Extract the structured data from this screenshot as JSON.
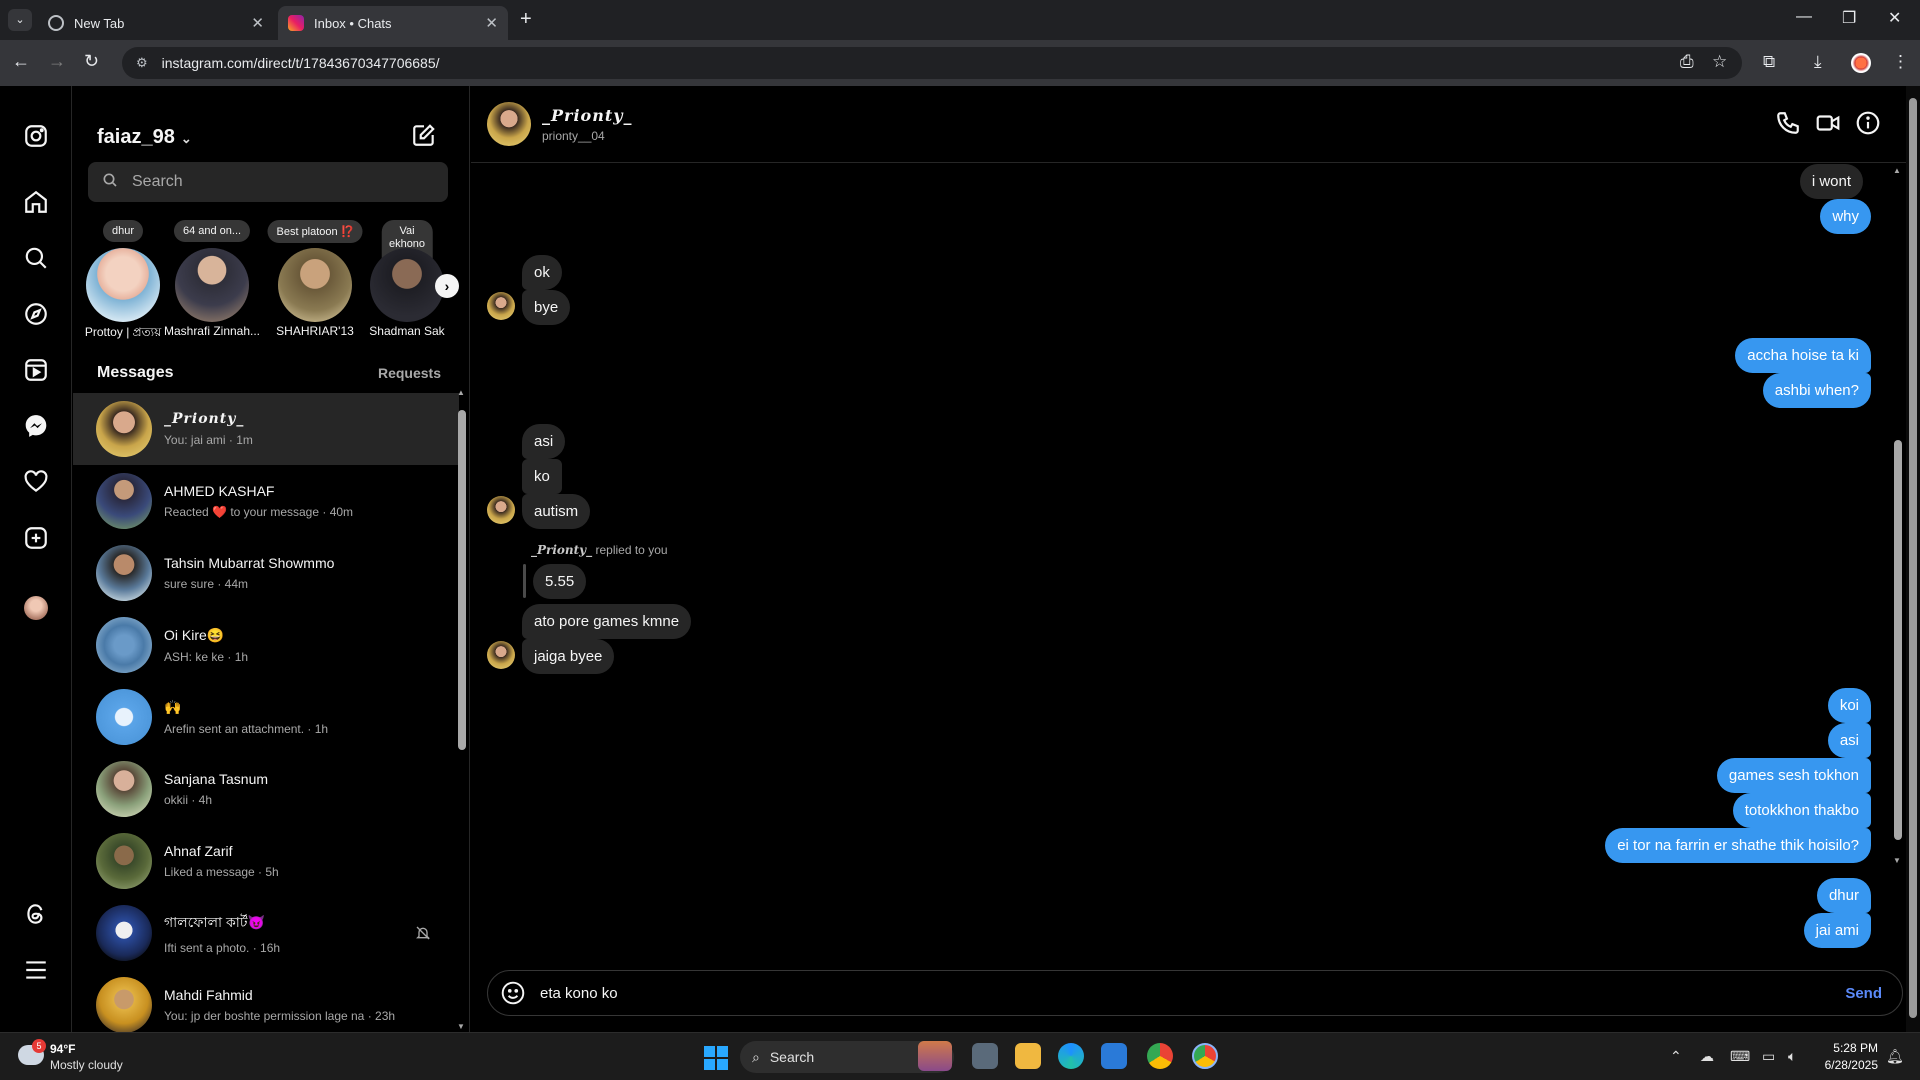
{
  "browser": {
    "tabs": [
      {
        "title": "New Tab",
        "active": false
      },
      {
        "title": "Inbox • Chats",
        "active": true
      }
    ],
    "url": "instagram.com/direct/t/17843670347706685/"
  },
  "inbox": {
    "username": "faiaz_98",
    "search_placeholder": "Search",
    "notes": [
      {
        "note": "dhur",
        "name": "Prottoy | প্রত্যয়"
      },
      {
        "note": "64 and on...",
        "name": "Mashrafi Zinnah..."
      },
      {
        "note": "Best platoon ⁉️",
        "name": "SHAHRIAR'13"
      },
      {
        "note": "Vai ekhono onekdin ba",
        "name": "Shadman Sak"
      }
    ],
    "messages_heading": "Messages",
    "requests_label": "Requests",
    "conversations": [
      {
        "name": "_Prionty_",
        "preview": "You: jai ami · 1m",
        "active": true
      },
      {
        "name": "AHMED KASHAF",
        "preview_before": "Reacted ",
        "preview_heart": "❤️",
        "preview_after": " to your message · 40m"
      },
      {
        "name": "Tahsin Mubarrat Showmmo",
        "preview": "sure sure · 44m"
      },
      {
        "name": "Oi Kire😆",
        "preview": "ASH: ke ke · 1h"
      },
      {
        "name": "🙌",
        "preview": "Arefin sent an attachment. · 1h"
      },
      {
        "name": "Sanjana Tasnum",
        "preview": "okkii · 4h"
      },
      {
        "name": "Ahnaf Zarif",
        "preview": "Liked a message · 5h"
      },
      {
        "name": "গালফোলা কার্ট😈",
        "preview": "Ifti sent a photo. · 16h",
        "muted": true
      },
      {
        "name": "Mahdi Fahmid",
        "preview": "You: jp der boshte permission lage na · 23h"
      }
    ]
  },
  "chat": {
    "header_name": "_Prionty_",
    "header_handle": "prionty__04",
    "messages": [
      {
        "from": "me",
        "text": "i wont",
        "style": "grey"
      },
      {
        "from": "me",
        "text": "why"
      },
      {
        "from": "them",
        "text": "ok"
      },
      {
        "from": "them",
        "text": "bye"
      },
      {
        "from": "me",
        "text": "accha hoise ta ki"
      },
      {
        "from": "me",
        "text": "ashbi when?"
      },
      {
        "from": "them",
        "text": "asi"
      },
      {
        "from": "them",
        "text": "ko"
      },
      {
        "from": "them",
        "text": "autism"
      },
      {
        "from": "them",
        "reply_name": "_Prionty_",
        "reply_suffix": " replied to you",
        "text": "5.55"
      },
      {
        "from": "them",
        "text": "ato pore games kmne"
      },
      {
        "from": "them",
        "text": "jaiga byee"
      },
      {
        "from": "me",
        "text": "koi"
      },
      {
        "from": "me",
        "text": "asi"
      },
      {
        "from": "me",
        "text": "games sesh tokhon"
      },
      {
        "from": "me",
        "text": "totokkhon thakbo"
      },
      {
        "from": "me",
        "text": "ei tor na farrin er shathe thik hoisilo?"
      },
      {
        "from": "me",
        "text": "dhur"
      },
      {
        "from": "me",
        "text": "jai ami"
      }
    ],
    "composer_value": "eta kono ko",
    "send_label": "Send"
  },
  "taskbar": {
    "weather_badge": "5",
    "weather_temp": "94°F",
    "weather_desc": "Mostly cloudy",
    "search_label": "Search",
    "time": "5:28 PM",
    "date": "6/28/2025"
  },
  "colors": {
    "outgoing_bubble": "#3797f0",
    "incoming_bubble": "#262626",
    "active_row": "#262626",
    "send_text": "#5b8af9"
  }
}
